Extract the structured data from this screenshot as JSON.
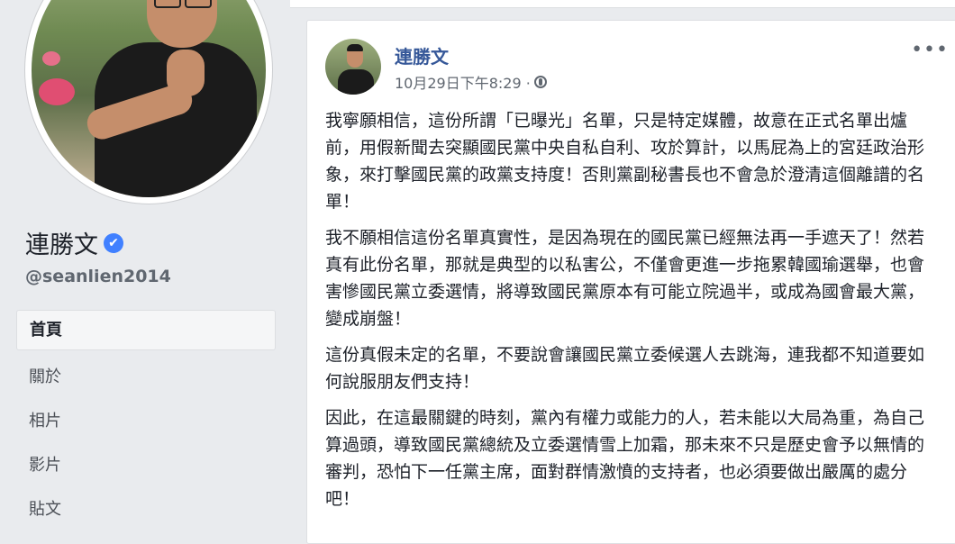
{
  "sidebar": {
    "page_name": "連勝文",
    "verified_icon": "✔",
    "handle": "@seanlien2014",
    "nav": [
      "首頁",
      "關於",
      "相片",
      "影片",
      "貼文"
    ]
  },
  "post": {
    "author": "連勝文",
    "timestamp": "10月29日下午8:29 ·",
    "more_icon": "•••",
    "paragraphs": [
      "我寧願相信，這份所謂「已曝光」名單，只是特定媒體，故意在正式名單出爐前，用假新聞去突顯國民黨中央自私自利、攻於算計，以馬屁為上的宮廷政治形象，來打擊國民黨的政黨支持度！否則黨副秘書長也不會急於澄清這個離譜的名單！",
      "我不願相信這份名單真實性，是因為現在的國民黨已經無法再一手遮天了！然若真有此份名單，那就是典型的以私害公，不僅會更進一步拖累韓國瑜選舉，也會害慘國民黨立委選情，將導致國民黨原本有可能立院過半，或成為國會最大黨，變成崩盤！",
      "這份真假未定的名單，不要說會讓國民黨立委候選人去跳海，連我都不知道要如何說服朋友們支持！",
      "因此，在這最關鍵的時刻，黨內有權力或能力的人，若未能以大局為重，為自己算過頭，導致國民黨總統及立委選情雪上加霜，那未來不只是歷史會予以無情的審判，恐怕下一任黨主席，面對群情激憤的支持者，也必須要做出嚴厲的處分吧！"
    ]
  },
  "colors": {
    "link": "#365899",
    "verified": "#4080ff",
    "background": "#e9ebee"
  }
}
